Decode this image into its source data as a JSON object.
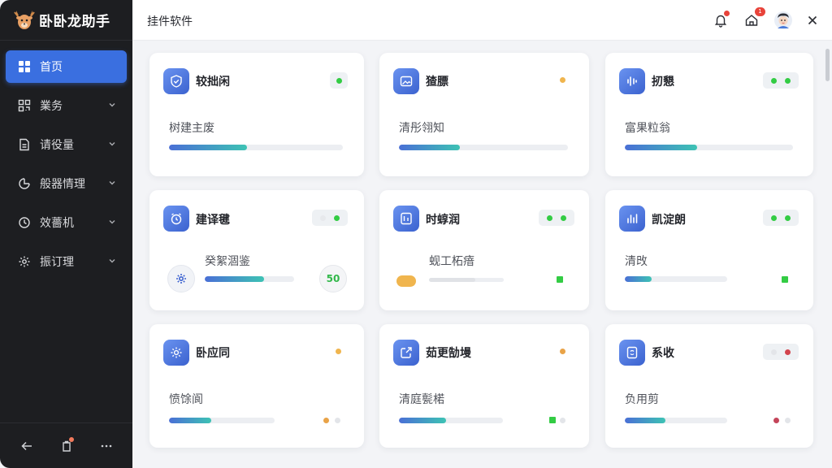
{
  "app": {
    "name": "卧卧龙助手"
  },
  "header": {
    "title": "挂件软件",
    "notification_count": "1"
  },
  "sidebar": {
    "items": [
      {
        "label": "首页",
        "icon": "grid-icon",
        "active": true
      },
      {
        "label": "業务",
        "icon": "qr-icon",
        "active": false
      },
      {
        "label": "请役量",
        "icon": "doc-icon",
        "active": false
      },
      {
        "label": "般器情理",
        "icon": "pie-icon",
        "active": false
      },
      {
        "label": "效薔机",
        "icon": "clock-icon",
        "active": false
      },
      {
        "label": "振订理",
        "icon": "settings-icon",
        "active": false
      }
    ]
  },
  "cards": [
    {
      "title": "较拙闲",
      "subtitle": "树建主废",
      "icon": "shield-icon",
      "progress": 0.45
    },
    {
      "title": "猹膘",
      "subtitle": "清彤翎知",
      "icon": "image-icon",
      "progress": 0.36
    },
    {
      "title": "扨懇",
      "subtitle": "富果粒翁",
      "icon": "waveform-icon",
      "progress": 0.43
    },
    {
      "title": "建译毽",
      "subtitle": "癸絮涸鉴",
      "icon": "alarm-icon",
      "progress": 0.66,
      "value": "50"
    },
    {
      "title": "时蜳润",
      "subtitle": "蚬工柘瘖",
      "icon": "device-icon",
      "progress": 0.62
    },
    {
      "title": "凯淀朗",
      "subtitle": "清攺",
      "icon": "chart-icon",
      "progress": 0.26
    },
    {
      "title": "卧应同",
      "subtitle": "愤馀阆",
      "icon": "gear-icon",
      "progress": 0.4
    },
    {
      "title": "茹更勂墁",
      "subtitle": "清庭甏楉",
      "icon": "share-icon",
      "progress": 0.45
    },
    {
      "title": "系收",
      "subtitle": "负用剪",
      "icon": "phone-refresh-icon",
      "progress": 0.4
    }
  ],
  "colors": {
    "accent": "#3a6fe0",
    "green": "#33cc44",
    "amber": "#f0b54e",
    "red": "#d2444d",
    "orange": "#e9a347"
  }
}
